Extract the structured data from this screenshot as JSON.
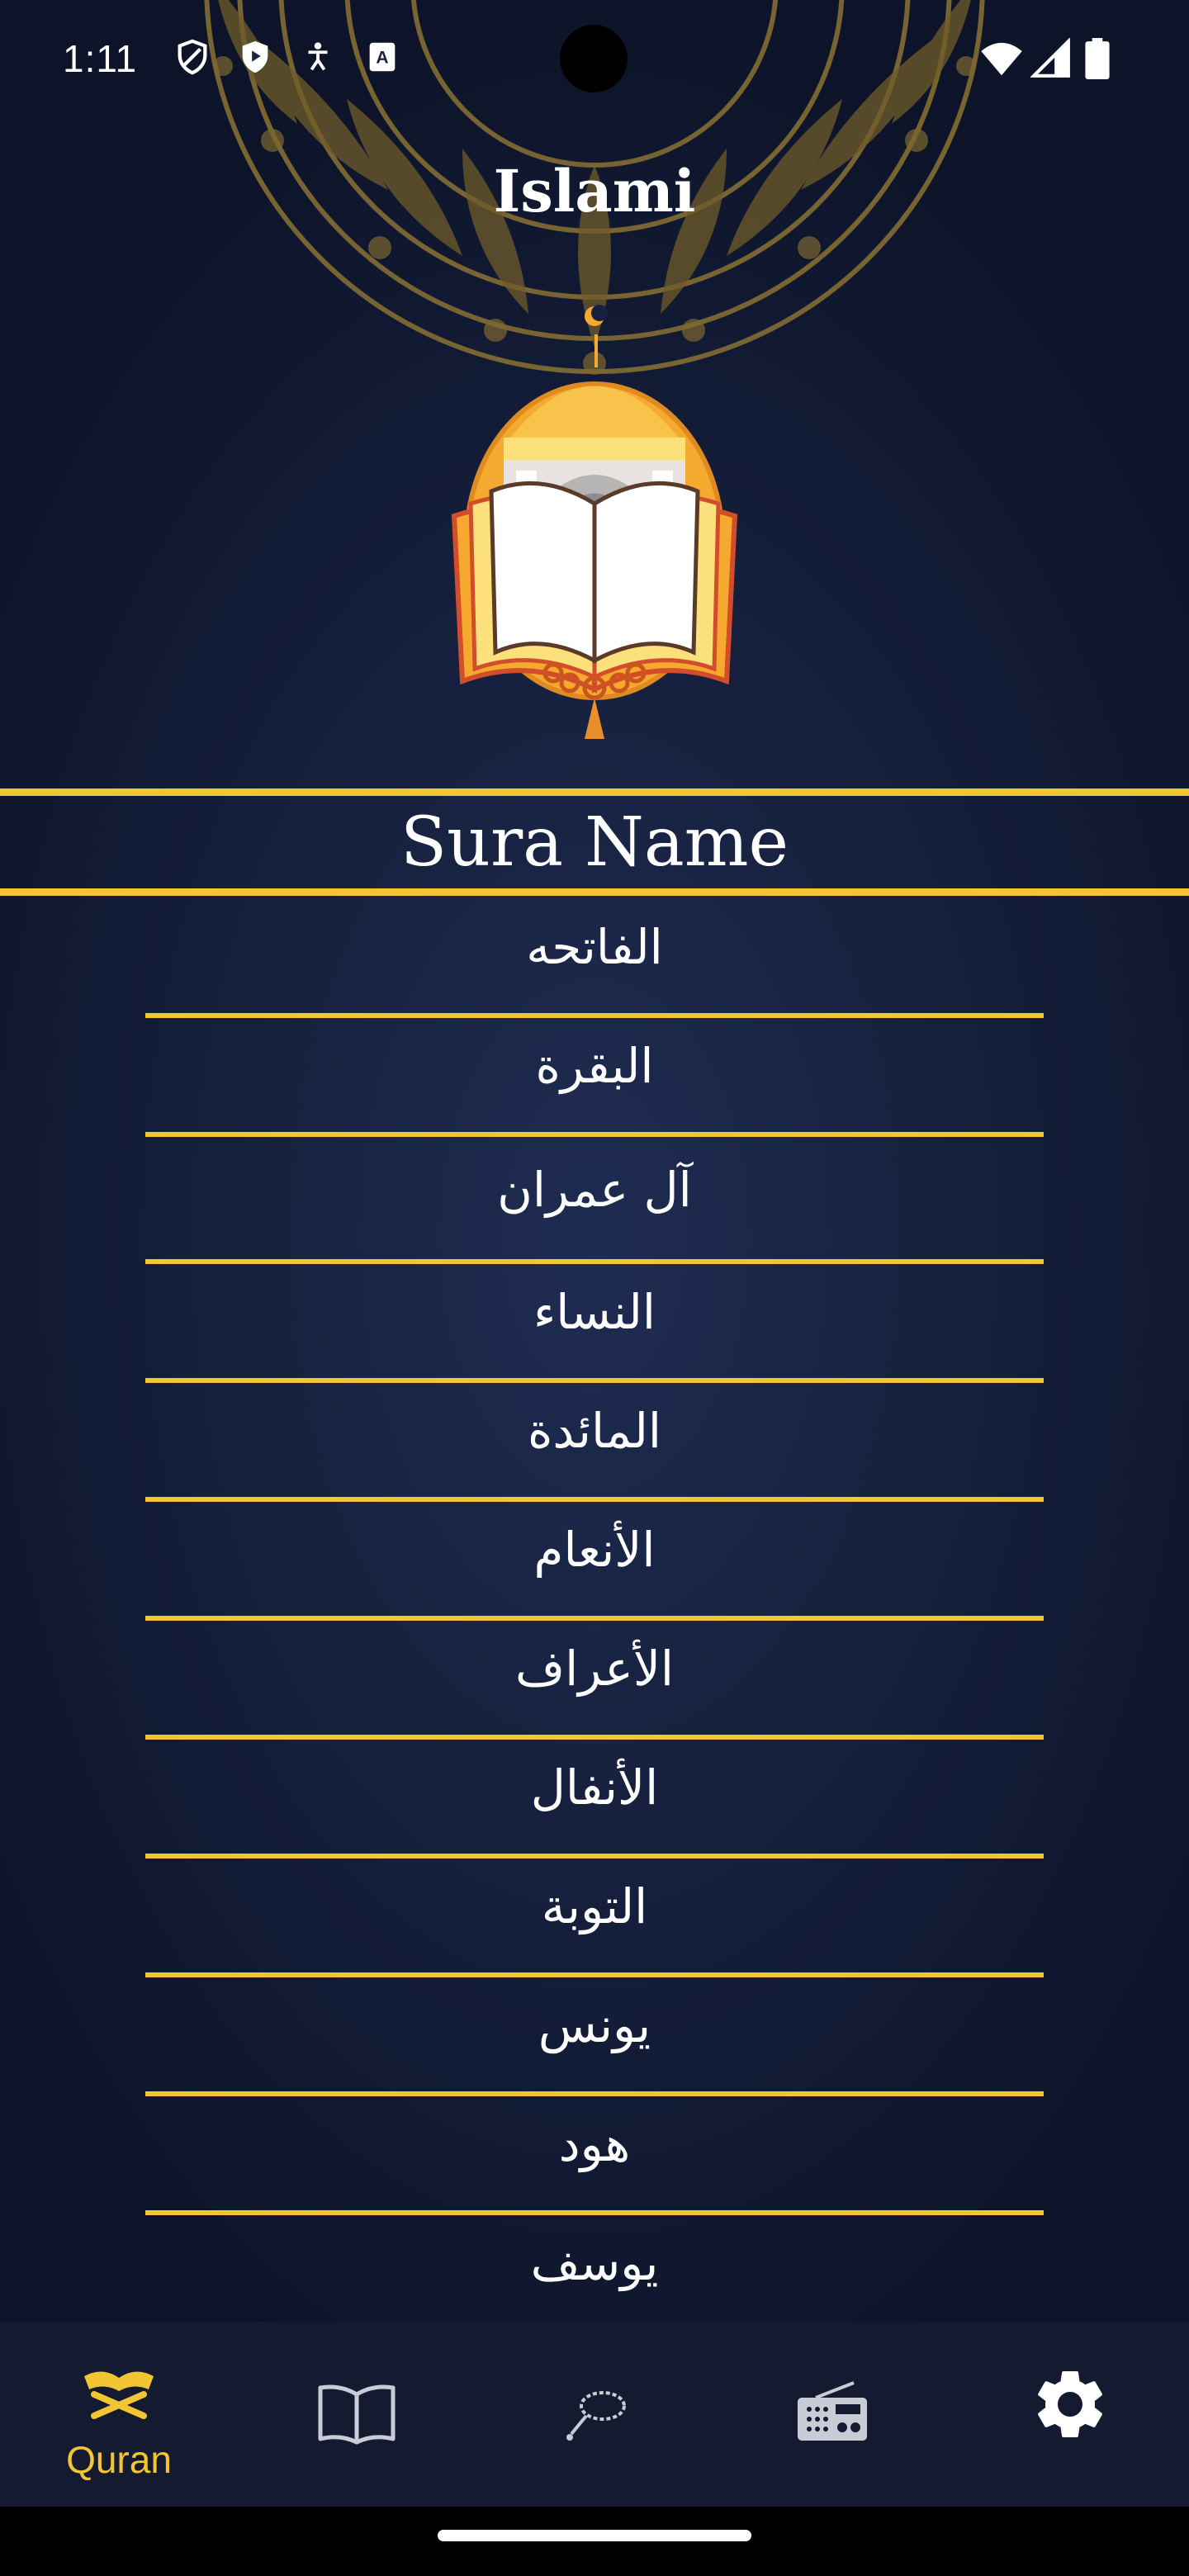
{
  "status_bar": {
    "time": "1:11",
    "left_icons": [
      "shield-icon",
      "play-protect-icon",
      "accessibility-icon",
      "keyboard-a-icon"
    ],
    "right_icons": [
      "wifi-icon",
      "signal-icon",
      "battery-icon"
    ]
  },
  "app": {
    "title": "Islami"
  },
  "sura_list": {
    "header": "Sura Name",
    "items": [
      "الفاتحه",
      "البقرة",
      "آل عمران",
      "النساء",
      "المائدة",
      "الأنعام",
      "الأعراف",
      "الأنفال",
      "التوبة",
      "يونس",
      "هود",
      "يوسف"
    ]
  },
  "bottom_nav": {
    "items": [
      {
        "icon": "quran-icon",
        "label": "Quran",
        "active": true
      },
      {
        "icon": "book-icon",
        "label": "",
        "active": false
      },
      {
        "icon": "tasbeeh-icon",
        "label": "",
        "active": false
      },
      {
        "icon": "radio-icon",
        "label": "",
        "active": false
      },
      {
        "icon": "settings-icon",
        "label": "",
        "active": false
      }
    ]
  },
  "colors": {
    "accent": "#f2c533",
    "background": "#17213f",
    "nav_background": "#141b30",
    "text": "#ffffff"
  }
}
